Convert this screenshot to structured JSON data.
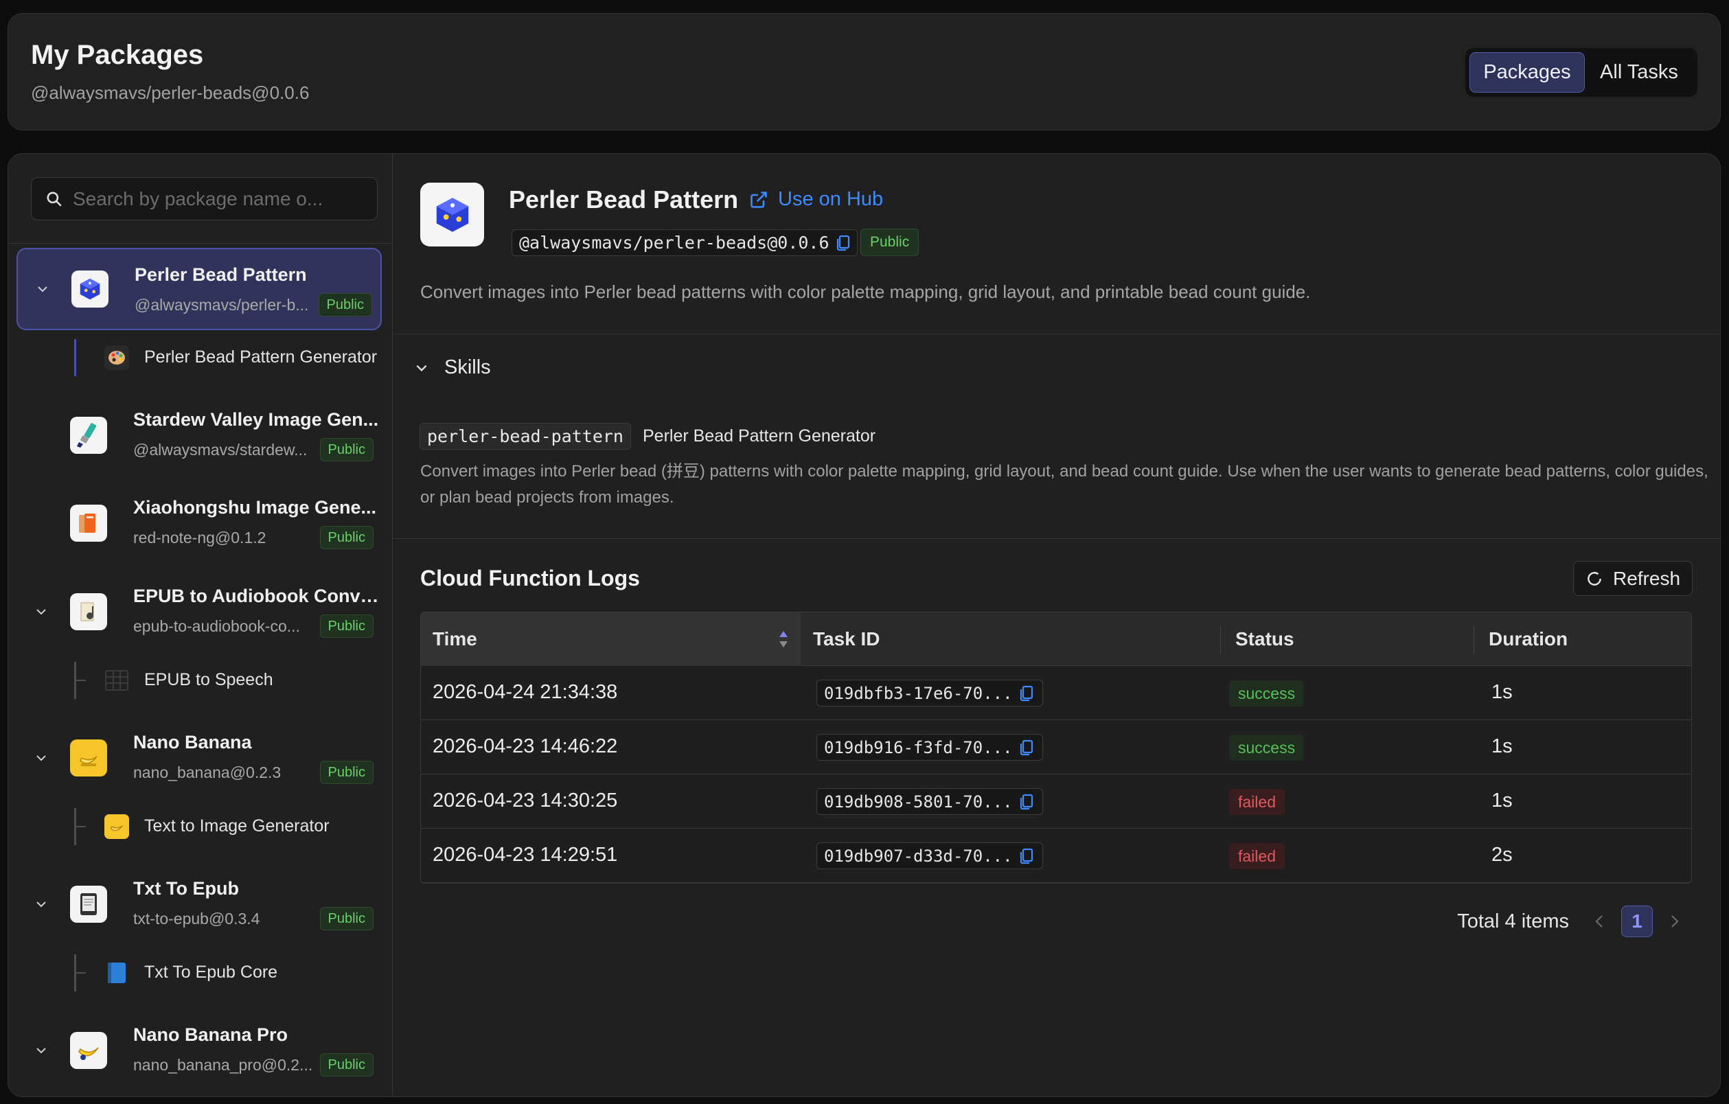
{
  "header": {
    "title": "My Packages",
    "subtitle": "@alwaysmavs/perler-beads@0.0.6",
    "tabs": [
      {
        "label": "Packages",
        "active": true
      },
      {
        "label": "All Tasks",
        "active": false
      }
    ]
  },
  "sidebar": {
    "search_placeholder": "Search by package name o...",
    "packages": [
      {
        "name": "Perler Bead Pattern",
        "sub": "@alwaysmavs/perler-b...",
        "badge": "Public",
        "icon": "blue-dice-icon",
        "expanded": true,
        "selected": true,
        "skills": [
          {
            "label": "Perler Bead Pattern Generator",
            "icon": "palette-icon"
          }
        ]
      },
      {
        "name": "Stardew Valley Image Gen...",
        "sub": "@alwaysmavs/stardew...",
        "badge": "Public",
        "icon": "paintbrush-icon",
        "expanded": false,
        "skills": []
      },
      {
        "name": "Xiaohongshu Image Gene...",
        "sub": "red-note-ng@0.1.2",
        "badge": "Public",
        "icon": "red-note-icon",
        "expanded": false,
        "skills": []
      },
      {
        "name": "EPUB to Audiobook Conve...",
        "sub": "epub-to-audiobook-co...",
        "badge": "Public",
        "icon": "book-audio-icon",
        "expanded": true,
        "skills": [
          {
            "label": "EPUB to Speech",
            "icon": "grid-icon"
          }
        ]
      },
      {
        "name": "Nano Banana",
        "sub": "nano_banana@0.2.3",
        "badge": "Public",
        "icon": "banana-icon",
        "expanded": true,
        "skills": [
          {
            "label": "Text to Image Generator",
            "icon": "banana-icon"
          }
        ]
      },
      {
        "name": "Txt To Epub",
        "sub": "txt-to-epub@0.3.4",
        "badge": "Public",
        "icon": "ebook-reader-icon",
        "expanded": true,
        "skills": [
          {
            "label": "Txt To Epub Core",
            "icon": "blue-book-icon"
          }
        ]
      },
      {
        "name": "Nano Banana Pro",
        "sub": "nano_banana_pro@0.2...",
        "badge": "Public",
        "icon": "banana-pro-icon",
        "expanded": true,
        "skills": []
      }
    ]
  },
  "detail": {
    "title": "Perler Bead Pattern",
    "hub_link": "Use on Hub",
    "package_id": "@alwaysmavs/perler-beads@0.0.6",
    "badge": "Public",
    "description": "Convert images into Perler bead patterns with color palette mapping, grid layout, and printable bead count guide.",
    "skills_heading": "Skills",
    "skill": {
      "code": "perler-bead-pattern",
      "name": "Perler Bead Pattern Generator",
      "description": "Convert images into Perler bead (拼豆) patterns with color palette mapping, grid layout, and bead count guide. Use when the user wants to generate bead patterns, color guides, or plan bead projects from images."
    },
    "logs": {
      "title": "Cloud Function Logs",
      "refresh_label": "Refresh",
      "columns": [
        "Time",
        "Task ID",
        "Status",
        "Duration"
      ],
      "rows": [
        {
          "time": "2026-04-24 21:34:38",
          "task_id": "019dbfb3-17e6-70...",
          "status": "success",
          "duration": "1s"
        },
        {
          "time": "2026-04-23 14:46:22",
          "task_id": "019db916-f3fd-70...",
          "status": "success",
          "duration": "1s"
        },
        {
          "time": "2026-04-23 14:30:25",
          "task_id": "019db908-5801-70...",
          "status": "failed",
          "duration": "1s"
        },
        {
          "time": "2026-04-23 14:29:51",
          "task_id": "019db907-d33d-70...",
          "status": "failed",
          "duration": "2s"
        }
      ],
      "total_label": "Total 4 items",
      "current_page": "1"
    }
  },
  "colors": {
    "accent": "#545aa6",
    "link": "#3d8bff",
    "success": "#58c058",
    "failed": "#e05860",
    "public_badge": "#6ad06a"
  }
}
